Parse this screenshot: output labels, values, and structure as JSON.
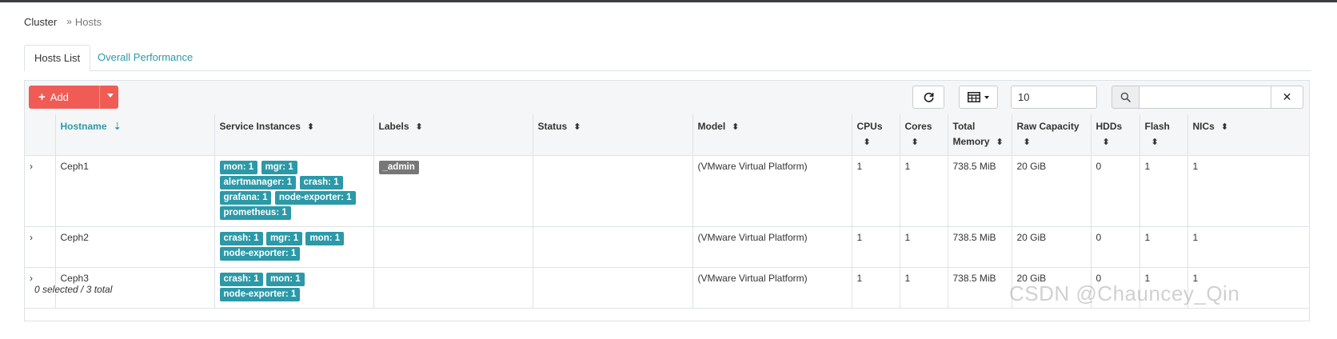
{
  "breadcrumb": {
    "root": "Cluster",
    "separator": "»",
    "current": "Hosts"
  },
  "tabs": [
    {
      "label": "Hosts List",
      "active": true
    },
    {
      "label": "Overall Performance",
      "active": false
    }
  ],
  "toolbar": {
    "add_label": "Add",
    "add_icon": "plus-icon",
    "refresh_icon": "refresh-icon",
    "columns_icon": "table-columns-icon",
    "per_page_value": "10",
    "search_icon": "search-icon",
    "search_value": "",
    "clear_icon": "close-icon",
    "clear_glyph": "✕"
  },
  "columns": [
    {
      "label": "Hostname",
      "sort_glyph": "⇣",
      "sorted": true
    },
    {
      "label": "Service Instances",
      "sort_glyph": "⬍"
    },
    {
      "label": "Labels",
      "sort_glyph": "⬍"
    },
    {
      "label": "Status",
      "sort_glyph": "⬍"
    },
    {
      "label": "Model",
      "sort_glyph": "⬍"
    },
    {
      "label": "CPUs",
      "sort_glyph": "⬍"
    },
    {
      "label": "Cores",
      "sort_glyph": "⬍"
    },
    {
      "label": "Total Memory",
      "sort_glyph": "⬍"
    },
    {
      "label": "Raw Capacity",
      "sort_glyph": "⬍"
    },
    {
      "label": "HDDs",
      "sort_glyph": "⬍"
    },
    {
      "label": "Flash",
      "sort_glyph": "⬍"
    },
    {
      "label": "NICs",
      "sort_glyph": "⬍"
    }
  ],
  "rows": [
    {
      "expand": "›",
      "hostname": "Ceph1",
      "services": [
        "mon: 1",
        "mgr: 1",
        "alertmanager: 1",
        "crash: 1",
        "grafana: 1",
        "node-exporter: 1",
        "prometheus: 1"
      ],
      "labels": [
        "_admin"
      ],
      "status": "",
      "model": "(VMware Virtual Platform)",
      "cpus": "1",
      "cores": "1",
      "memory": "738.5 MiB",
      "raw_capacity": "20 GiB",
      "hdds": "0",
      "flash": "1",
      "nics": "1"
    },
    {
      "expand": "›",
      "hostname": "Ceph2",
      "services": [
        "crash: 1",
        "mgr: 1",
        "mon: 1",
        "node-exporter: 1"
      ],
      "labels": [],
      "status": "",
      "model": "(VMware Virtual Platform)",
      "cpus": "1",
      "cores": "1",
      "memory": "738.5 MiB",
      "raw_capacity": "20 GiB",
      "hdds": "0",
      "flash": "1",
      "nics": "1"
    },
    {
      "expand": "›",
      "hostname": "Ceph3",
      "services": [
        "crash: 1",
        "mon: 1",
        "node-exporter: 1"
      ],
      "labels": [],
      "status": "",
      "model": "(VMware Virtual Platform)",
      "cpus": "1",
      "cores": "1",
      "memory": "738.5 MiB",
      "raw_capacity": "20 GiB",
      "hdds": "0",
      "flash": "1",
      "nics": "1"
    }
  ],
  "footer": {
    "selection_text": "0 selected / 3 total"
  },
  "watermark": "CSDN @Chauncey_Qin",
  "colors": {
    "accent": "#2b99a8",
    "add_button": "#ef5c55",
    "label_badge": "#777777"
  }
}
